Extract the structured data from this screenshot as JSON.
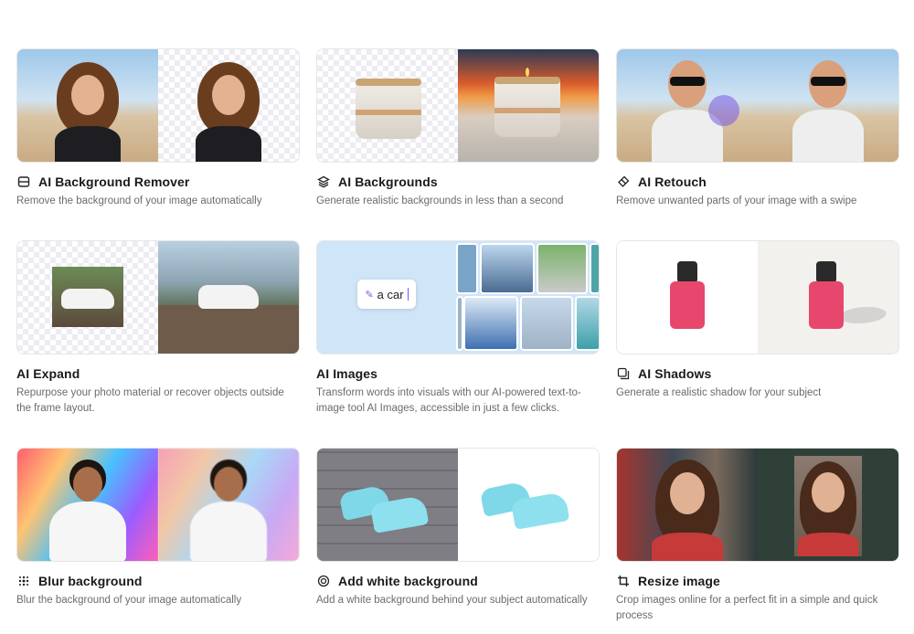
{
  "cards": [
    {
      "title": "AI Background Remover",
      "desc": "Remove the background of your image automatically",
      "icon": "background-remover-icon"
    },
    {
      "title": "AI Backgrounds",
      "desc": "Generate realistic backgrounds in less than a second",
      "icon": "layers-icon"
    },
    {
      "title": "AI Retouch",
      "desc": "Remove unwanted parts of your image with a swipe",
      "icon": "eraser-icon"
    },
    {
      "title": "AI Expand",
      "desc": "Repurpose your photo material or recover objects outside the frame layout.",
      "icon": ""
    },
    {
      "title": "AI Images",
      "desc": "Transform words into visuals with our AI-powered text-to-image tool AI Images, accessible in just a few clicks.",
      "icon": ""
    },
    {
      "title": "AI Shadows",
      "desc": "Generate a realistic shadow for your subject",
      "icon": "shadow-icon"
    },
    {
      "title": "Blur background",
      "desc": "Blur the background of your image automatically",
      "icon": "blur-icon"
    },
    {
      "title": "Add white background",
      "desc": "Add a white background behind your subject automatically",
      "icon": "white-background-icon"
    },
    {
      "title": "Resize image",
      "desc": "Crop images online for a perfect fit in a simple and quick process",
      "icon": "crop-icon"
    }
  ],
  "ai_images_prompt": "a car",
  "colors": {
    "accent": "#6d5dfc",
    "text": "#1a1a1a",
    "muted": "#6b6b6b"
  }
}
